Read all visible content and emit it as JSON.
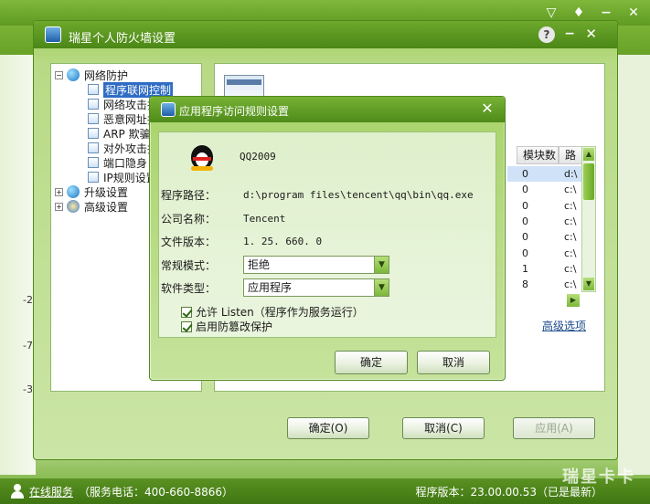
{
  "background": {
    "left_marks": [
      "-2",
      "-7",
      "-3"
    ],
    "window_controls": [
      "▽",
      "♦",
      "−",
      "✕"
    ]
  },
  "status_bar": {
    "online_service": "在线服务",
    "phone": "（服务电话：400-660-8866）",
    "version_label": "程序版本：23.00.00.53（已是最新）",
    "watermark": "瑞星卡卡"
  },
  "settings": {
    "title": "瑞星个人防火墙设置",
    "help": "?",
    "tree": {
      "root": "网络防护",
      "children": [
        "程序联网控制",
        "网络攻击拦截",
        "恶意网址拦截",
        "ARP 欺骗防御",
        "对外攻击拦截",
        "端口隐身",
        "IP规则设置"
      ],
      "upgrade": "升级设置",
      "advanced": "高级设置"
    },
    "table": {
      "headers": [
        "模块数",
        "路径"
      ],
      "modules": [
        "0",
        "0",
        "0",
        "0",
        "0",
        "0",
        "1",
        "8"
      ],
      "paths": [
        "d:\\",
        "c:\\",
        "c:\\",
        "c:\\",
        "c:\\",
        "c:\\",
        "c:\\",
        "c:\\"
      ]
    },
    "advanced_link": "高级选项",
    "buttons": {
      "ok": "确定(O)",
      "cancel": "取消(C)",
      "apply": "应用(A)"
    }
  },
  "dialog": {
    "title": "应用程序访问规则设置",
    "app_name": "QQ2009",
    "path_label": "程序路径：",
    "path_value": "d:\\program files\\tencent\\qq\\bin\\qq.exe",
    "company_label": "公司名称：",
    "company_value": "Tencent",
    "version_label": "文件版本：",
    "version_value": "1. 25. 660. 0",
    "mode_label": "常规模式：",
    "mode_value": "拒绝",
    "type_label": "软件类型：",
    "type_value": "应用程序",
    "allow_listen": "允许 Listen（程序作为服务运行）",
    "tamper_protect": "启用防篡改保护",
    "ok": "确定",
    "cancel": "取消"
  }
}
